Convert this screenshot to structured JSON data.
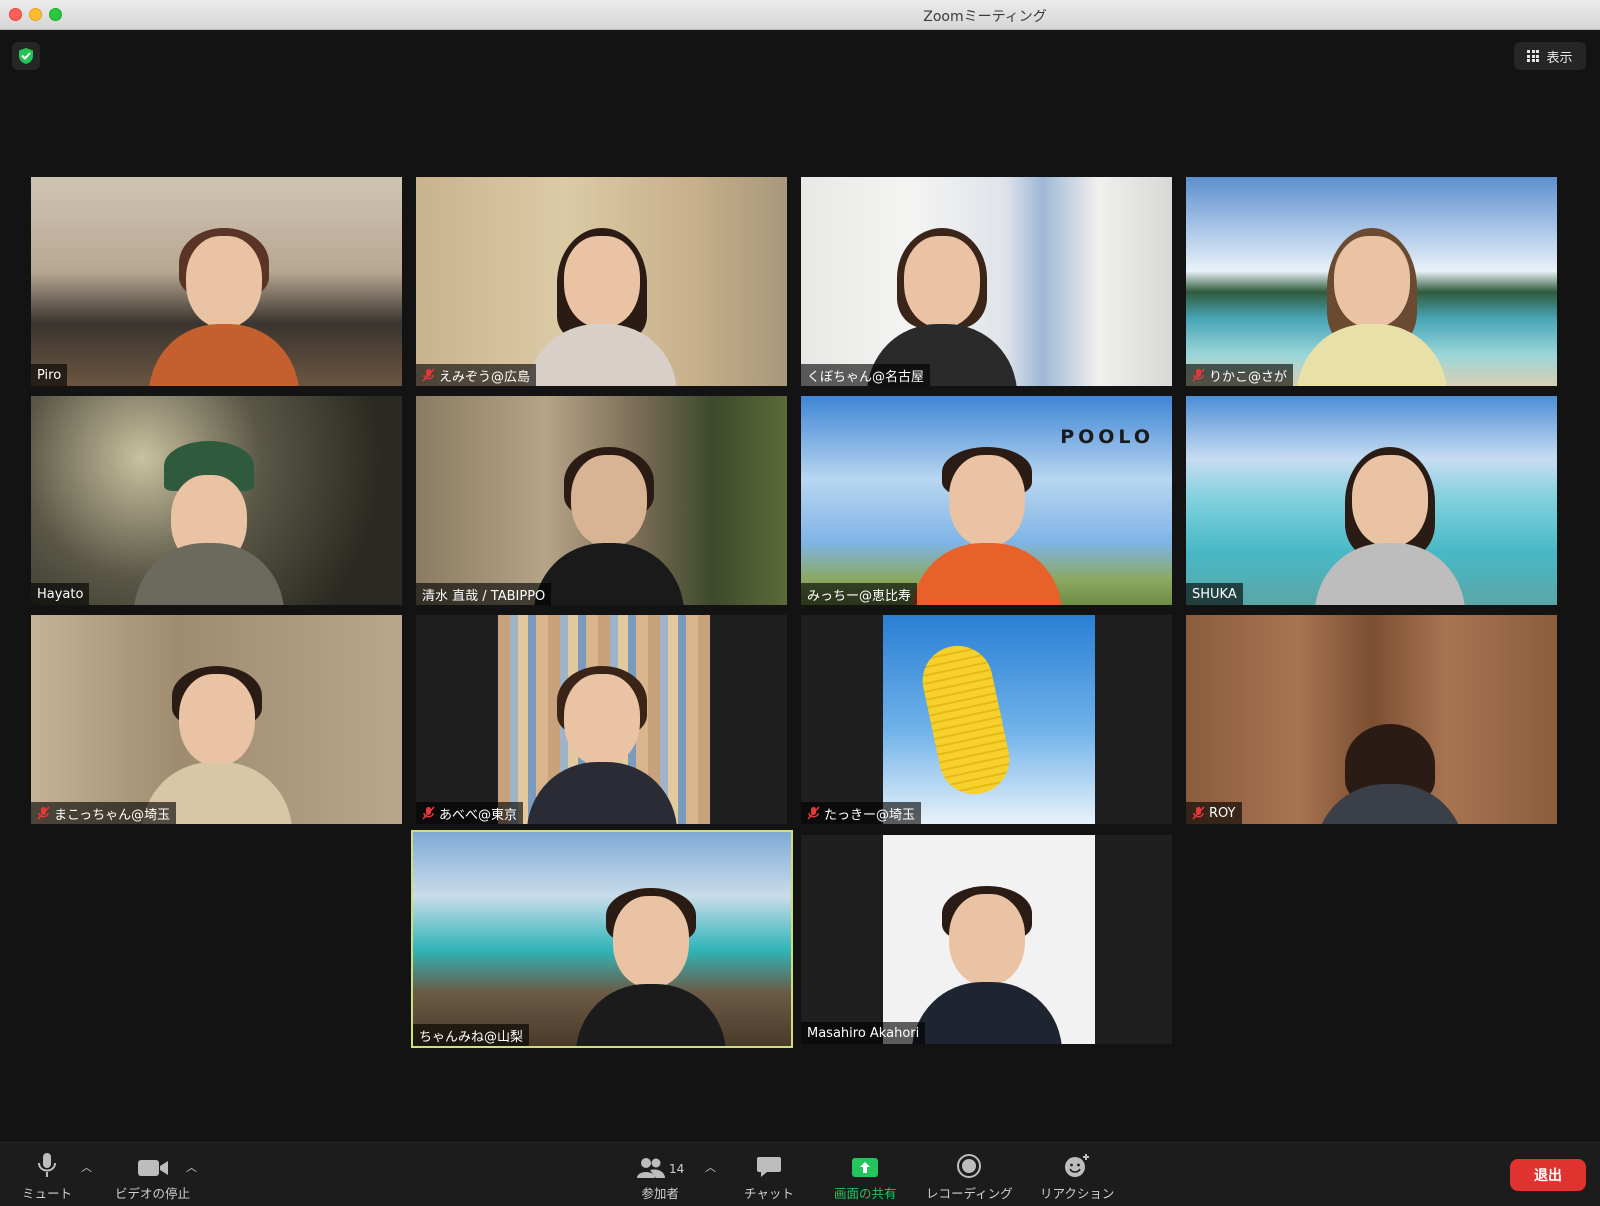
{
  "window": {
    "title": "Zoomミーティング"
  },
  "top_right": {
    "view_label": "表示"
  },
  "participants": [
    {
      "name": "Piro",
      "muted": false
    },
    {
      "name": "えみぞう@広島",
      "muted": true
    },
    {
      "name": "くぼちゃん@名古屋",
      "muted": false
    },
    {
      "name": "りかこ@さが",
      "muted": true
    },
    {
      "name": "Hayato",
      "muted": false
    },
    {
      "name": "清水 直哉 / TABIPPO",
      "muted": false
    },
    {
      "name": "みっちー@恵比寿",
      "muted": false
    },
    {
      "name": "SHUKA",
      "muted": false
    },
    {
      "name": "まこっちゃん@埼玉",
      "muted": true
    },
    {
      "name": "あべべ@東京",
      "muted": true
    },
    {
      "name": "たっきー@埼玉",
      "muted": true
    },
    {
      "name": "ROY",
      "muted": true
    },
    {
      "name": "ちゃんみね@山梨",
      "muted": false,
      "active_speaker": true
    },
    {
      "name": "Masahiro Akahori",
      "muted": false
    }
  ],
  "scene_text": {
    "poolo_logo": "POOLO"
  },
  "toolbar": {
    "mute": "ミュート",
    "stop_video": "ビデオの停止",
    "participants": "参加者",
    "participants_count": "14",
    "chat": "チャット",
    "share_screen": "画面の共有",
    "record": "レコーディング",
    "reactions": "リアクション",
    "leave": "退出"
  },
  "colors": {
    "background": "#131313",
    "share_green": "#22c55e",
    "leave_red": "#e0322e",
    "active_outline": "#cfe07a",
    "shield_green": "#23c552"
  }
}
